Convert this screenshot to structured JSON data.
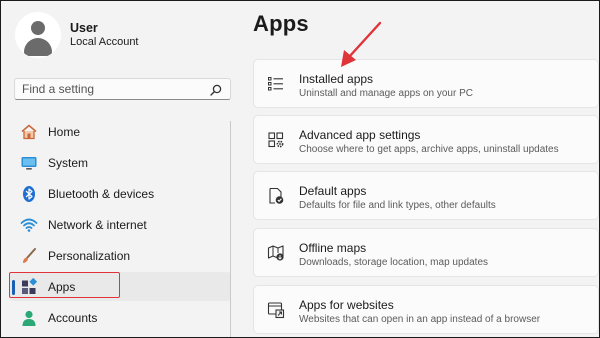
{
  "user": {
    "name": "User",
    "account_type": "Local Account"
  },
  "search": {
    "placeholder": "Find a setting"
  },
  "sidebar": {
    "items": [
      {
        "label": "Home",
        "icon": "home-icon"
      },
      {
        "label": "System",
        "icon": "system-icon"
      },
      {
        "label": "Bluetooth & devices",
        "icon": "bluetooth-icon"
      },
      {
        "label": "Network & internet",
        "icon": "wifi-icon"
      },
      {
        "label": "Personalization",
        "icon": "paintbrush-icon"
      },
      {
        "label": "Apps",
        "icon": "apps-icon",
        "selected": true
      },
      {
        "label": "Accounts",
        "icon": "accounts-icon"
      }
    ]
  },
  "main": {
    "title": "Apps",
    "cards": [
      {
        "title": "Installed apps",
        "description": "Uninstall and manage apps on your PC",
        "icon": "list-icon"
      },
      {
        "title": "Advanced app settings",
        "description": "Choose where to get apps, archive apps, uninstall updates",
        "icon": "apps-gear-icon"
      },
      {
        "title": "Default apps",
        "description": "Defaults for file and link types, other defaults",
        "icon": "default-apps-icon"
      },
      {
        "title": "Offline maps",
        "description": "Downloads, storage location, map updates",
        "icon": "map-icon"
      },
      {
        "title": "Apps for websites",
        "description": "Websites that can open in an app instead of a browser",
        "icon": "web-app-icon"
      }
    ]
  },
  "colors": {
    "accent": "#1a5fb4",
    "annotation": "#e0333a"
  }
}
